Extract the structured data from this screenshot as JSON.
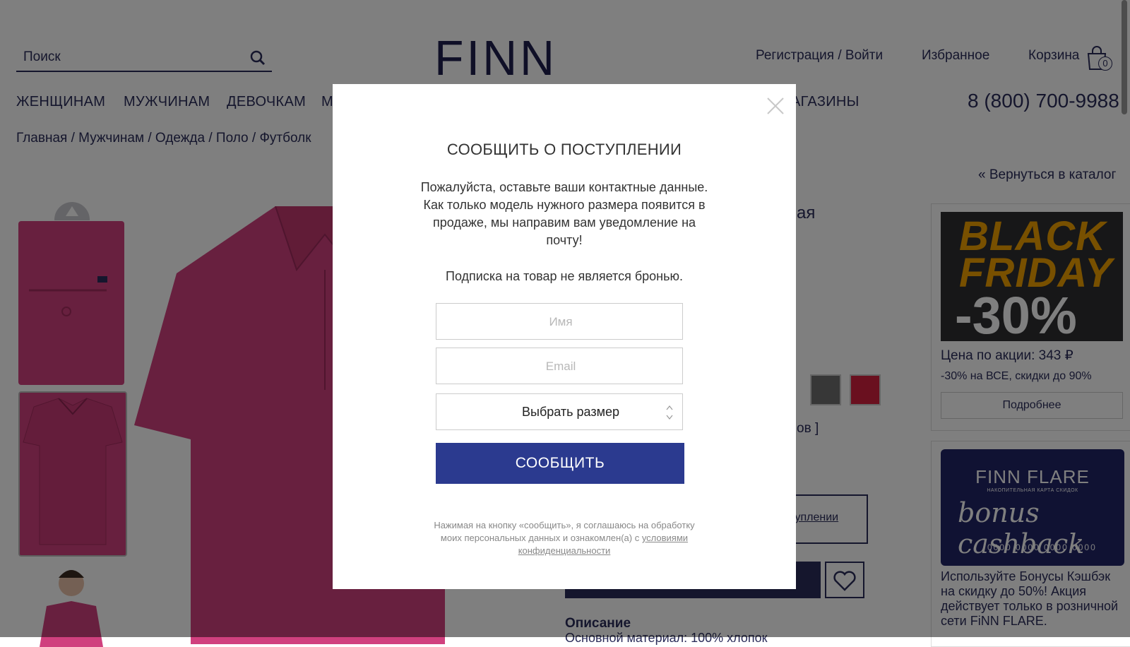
{
  "header": {
    "search_placeholder": "Поиск",
    "logo": "FINN FLARE",
    "register_login": "Регистрация / Войти",
    "favorites": "Избранное",
    "cart": "Корзина",
    "cart_count": "0",
    "phone": "8 (800) 700-9988"
  },
  "nav": {
    "items": [
      "ЖЕНЩИНАМ",
      "МУЖЧИНАМ",
      "ДЕВОЧКАМ",
      "М",
      "АГАЗИНЫ"
    ]
  },
  "breadcrumb": [
    "Главная",
    "Мужчинам",
    "Одежда",
    "Поло",
    "Футболк"
  ],
  "breadcrumb_separator": "/",
  "back_link": "« Вернуться в каталог",
  "product": {
    "title_fragment": "ая",
    "sizes_fragment": "ов ]",
    "notify_link_fragment": "ступлении",
    "description_title": "Описание",
    "description_fragment": "Основной материал: 100% хлопок"
  },
  "promo": {
    "line1": "BLACK",
    "line2": "FRIDAY",
    "discount": "-30%",
    "price": "Цена по акции: 343 ₽",
    "note": "-30% на ВСЕ, скидки до 90%",
    "button": "Подробнее"
  },
  "card": {
    "logo": "FINN FLARE",
    "subtitle": "НАКОПИТЕЛЬНАЯ КАРТА СКИДОК",
    "script": "bonus cashback",
    "number": "0000 0000 0000 0000",
    "text": "Используйте Бонусы Кэшбэк на скидку до 50%! Акция действует только в розничной сети FiNN FLARE."
  },
  "modal": {
    "title": "СООБЩИТЬ О ПОСТУПЛЕНИИ",
    "text": "Пожалуйста, оставьте ваши контактные данные. Как только модель нужного размера появится в продаже, мы направим вам уведомление на почту!",
    "note": "Подписка на товар не является бронью.",
    "name_placeholder": "Имя",
    "email_placeholder": "Email",
    "size_select": "Выбрать размер",
    "submit": "СООБЩИТЬ",
    "consent_text": "Нажимая на кнопку «сообщить», я соглашаюсь на обработку моих персональных данных и ознакомлен(а) с",
    "consent_link": "условиями конфиденциальности"
  },
  "colors": {
    "brand": "#2b2d5a",
    "submit": "#2b3a8f",
    "product_pink": "#d0407e",
    "swatch_red": "#d4203e",
    "promo_orange": "#f0a000"
  }
}
